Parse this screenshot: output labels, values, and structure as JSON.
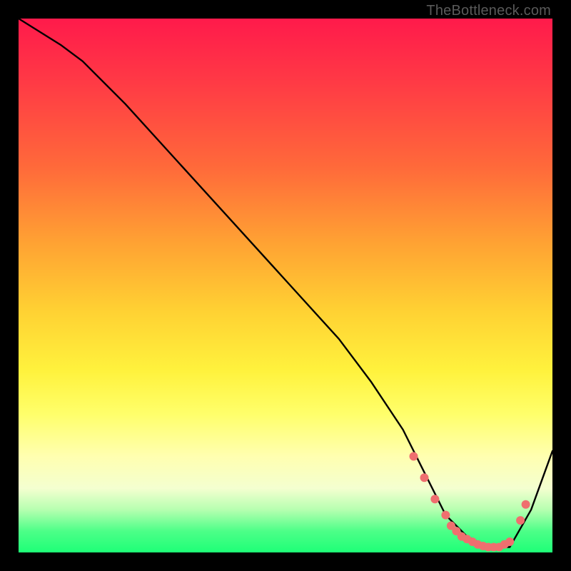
{
  "credit": "TheBottleneck.com",
  "chart_data": {
    "type": "line",
    "title": "",
    "xlabel": "",
    "ylabel": "",
    "xlim": [
      0,
      100
    ],
    "ylim": [
      0,
      100
    ],
    "series": [
      {
        "name": "bottleneck-curve",
        "x": [
          0,
          8,
          12,
          20,
          30,
          40,
          50,
          60,
          66,
          72,
          76,
          80,
          84,
          88,
          92,
          96,
          100
        ],
        "y": [
          100,
          95,
          92,
          84,
          73,
          62,
          51,
          40,
          32,
          23,
          15,
          7,
          3,
          1,
          1,
          8,
          19
        ]
      }
    ],
    "markers": {
      "name": "highlight-points",
      "color": "#ef6f6f",
      "x": [
        74,
        76,
        78,
        80,
        81,
        82,
        83,
        84,
        85,
        86,
        87,
        88,
        89,
        90,
        91,
        92,
        94,
        95
      ],
      "y": [
        18,
        14,
        10,
        7,
        5,
        4,
        3,
        2.5,
        2,
        1.5,
        1.2,
        1,
        1,
        1,
        1.5,
        2,
        6,
        9
      ]
    }
  }
}
